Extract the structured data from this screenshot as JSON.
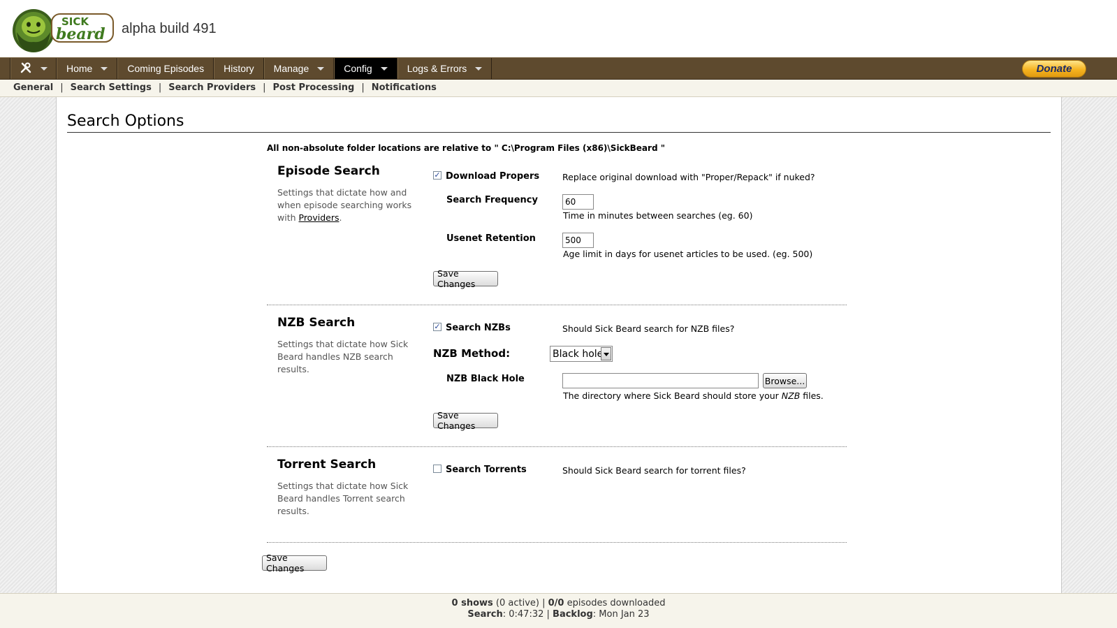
{
  "header": {
    "logo_text_sick": "SICK",
    "logo_text_beard": "beard",
    "build": "alpha build 491"
  },
  "nav": {
    "items": [
      {
        "label": "Home",
        "dropdown": true
      },
      {
        "label": "Coming Episodes",
        "dropdown": false
      },
      {
        "label": "History",
        "dropdown": false
      },
      {
        "label": "Manage",
        "dropdown": true
      },
      {
        "label": "Config",
        "dropdown": true,
        "active": true
      },
      {
        "label": "Logs & Errors",
        "dropdown": true
      }
    ],
    "tools_icon": "tools-icon",
    "donate_label": "Donate"
  },
  "subnav": {
    "items": [
      "General",
      "Search Settings",
      "Search Providers",
      "Post Processing",
      "Notifications"
    ],
    "separator": "|"
  },
  "page": {
    "title": "Search Options",
    "path_note": "All non-absolute folder locations are relative to \" C:\\Program Files (x86)\\SickBeard \""
  },
  "episode_search": {
    "title": "Episode Search",
    "desc_prefix": "Settings that dictate how and when episode searching works with ",
    "desc_link": "Providers",
    "desc_suffix": ".",
    "download_propers": {
      "label": "Download Propers",
      "checked": true,
      "help": "Replace original download with \"Proper/Repack\" if nuked?"
    },
    "search_frequency": {
      "label": "Search Frequency",
      "value": "60",
      "help": "Time in minutes between searches (eg. 60)"
    },
    "usenet_retention": {
      "label": "Usenet Retention",
      "value": "500",
      "help": "Age limit in days for usenet articles to be used. (eg. 500)"
    },
    "save_label": "Save Changes"
  },
  "nzb_search": {
    "title": "NZB Search",
    "desc": "Settings that dictate how Sick Beard handles NZB search results.",
    "search_nzbs": {
      "label": "Search NZBs",
      "checked": true,
      "help": "Should Sick Beard search for NZB files?"
    },
    "nzb_method": {
      "label": "NZB Method:",
      "value": "Black hole"
    },
    "black_hole": {
      "label": "NZB Black Hole",
      "value": "",
      "browse_label": "Browse...",
      "help_prefix": "The directory where Sick Beard should store your ",
      "help_em": "NZB",
      "help_suffix": " files."
    },
    "save_label": "Save Changes"
  },
  "torrent_search": {
    "title": "Torrent Search",
    "desc": "Settings that dictate how Sick Beard handles Torrent search results.",
    "search_torrents": {
      "label": "Search Torrents",
      "checked": false,
      "help": "Should Sick Beard search for torrent files?"
    }
  },
  "bottom_save_label": "Save Changes",
  "footer": {
    "shows_count": "0 shows",
    "shows_active": "(0 active)",
    "episodes": "0/0",
    "episodes_suffix": "episodes downloaded",
    "search_label": "Search",
    "search_value": ": 0:47:32",
    "backlog_label": "Backlog",
    "backlog_value": ": Mon Jan 23"
  },
  "colors": {
    "navbar": "#5e4a2e",
    "subnav_bg": "#f6f4eb",
    "logo_green": "#3f7a1f",
    "donate": "#f6b320"
  }
}
